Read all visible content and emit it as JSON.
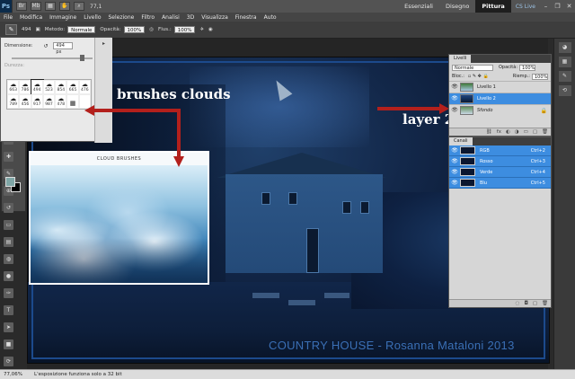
{
  "appbar": {
    "logo": "Ps",
    "zoom": "77,1",
    "workspaces": [
      "Essenziali",
      "Disegno",
      "Pittura"
    ],
    "active_workspace": "Pittura",
    "cs_live": "CS Live"
  },
  "menu": [
    "File",
    "Modifica",
    "Immagine",
    "Livello",
    "Selezione",
    "Filtro",
    "Analisi",
    "3D",
    "Visualizza",
    "Finestra",
    "Auto"
  ],
  "options": {
    "brush_size": "494",
    "metodo_label": "Metodo:",
    "metodo_value": "Normale",
    "opacita_label": "Opacità:",
    "opacita_value": "100%",
    "flusso_label": "Flus.:",
    "flusso_value": "100%"
  },
  "brush_panel": {
    "dimensione_label": "Dimensione:",
    "dimensione_value": "494 px",
    "durezza_label": "Durezza:",
    "brushes": [
      {
        "n": "663"
      },
      {
        "n": "786"
      },
      {
        "n": "494"
      },
      {
        "n": "523"
      },
      {
        "n": "854"
      },
      {
        "n": "665"
      },
      {
        "n": "476"
      },
      {
        "n": "789"
      },
      {
        "n": "456"
      },
      {
        "n": "917"
      },
      {
        "n": "987"
      },
      {
        "n": "478"
      },
      {
        "n": ""
      },
      {
        "n": ""
      }
    ]
  },
  "cloud_image": {
    "title": "CLOUD BRUSHES"
  },
  "annotations": {
    "brushes_label": "brushes clouds",
    "layer_label": "layer 2"
  },
  "canvas": {
    "watermark": "COUNTRY HOUSE - Rosanna Mataloni 2013"
  },
  "layers_panel": {
    "tab": "Livelli",
    "blend_mode": "Normale",
    "opacity_label": "Opacità:",
    "opacity_value": "100%",
    "lock_label": "Bloc.:",
    "fill_label": "Riemp.:",
    "fill_value": "100%",
    "layers": [
      {
        "name": "Livello 1",
        "selected": false
      },
      {
        "name": "Livello 2",
        "selected": true
      },
      {
        "name": "Sfondo",
        "selected": false
      }
    ]
  },
  "channels_panel": {
    "tab": "Canali",
    "channels": [
      {
        "name": "RGB",
        "key": "Ctrl+2"
      },
      {
        "name": "Rosso",
        "key": "Ctrl+3"
      },
      {
        "name": "Verde",
        "key": "Ctrl+4"
      },
      {
        "name": "Blu",
        "key": "Ctrl+5"
      }
    ]
  },
  "status": {
    "zoom": "77,06%",
    "message": "L'esposizione funziona solo a 32 bit"
  },
  "colors": {
    "accent": "#3d8de0",
    "arrow": "#b3201c",
    "watermark": "#3a6fb5"
  }
}
